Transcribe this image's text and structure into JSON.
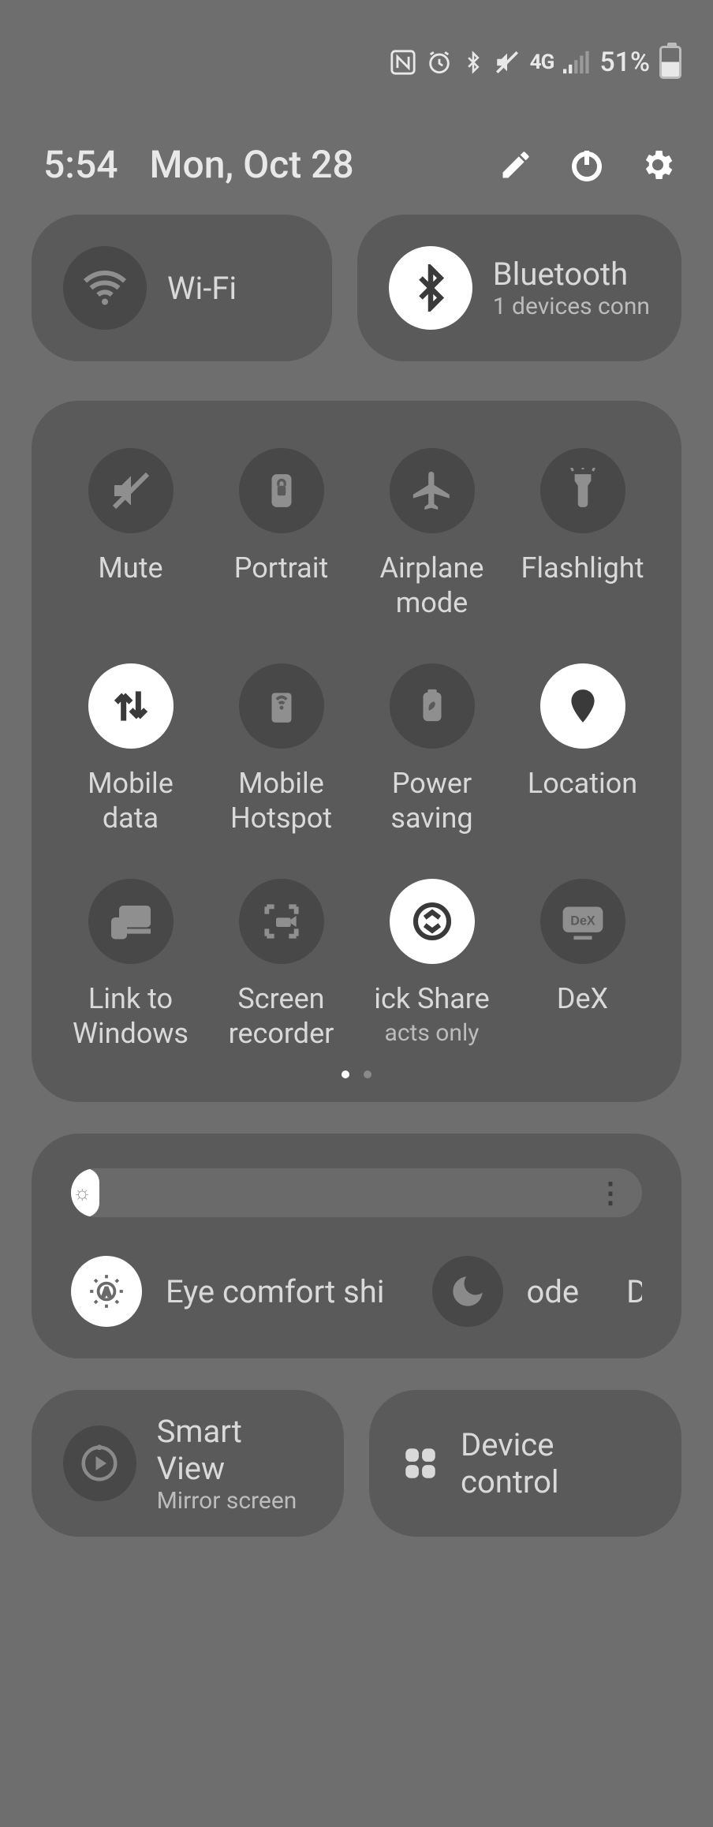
{
  "status": {
    "network_type": "4G",
    "battery_pct": "51%"
  },
  "header": {
    "time": "5:54",
    "date": "Mon, Oct 28"
  },
  "wide": {
    "wifi": {
      "label": "Wi-Fi",
      "active": false
    },
    "bluetooth": {
      "label": "Bluetooth",
      "sub": "1 devices conn",
      "active": true
    }
  },
  "qs": [
    {
      "id": "mute",
      "label": "Mute",
      "active": false,
      "icon": "mute"
    },
    {
      "id": "portrait",
      "label": "Portrait",
      "active": false,
      "icon": "lock-rotate"
    },
    {
      "id": "airplane",
      "label": "Airplane\nmode",
      "active": false,
      "icon": "airplane"
    },
    {
      "id": "flashlight",
      "label": "Flashlight",
      "active": false,
      "icon": "flashlight"
    },
    {
      "id": "mobile-data",
      "label": "Mobile\ndata",
      "active": true,
      "icon": "arrows"
    },
    {
      "id": "mobile-hotspot",
      "label": "Mobile\nHotspot",
      "active": false,
      "icon": "hotspot"
    },
    {
      "id": "power-saving",
      "label": "Power\nsaving",
      "active": false,
      "icon": "battery-leaf"
    },
    {
      "id": "location",
      "label": "Location",
      "active": true,
      "icon": "pin"
    },
    {
      "id": "link-windows",
      "label": "Link to\nWindows",
      "active": false,
      "icon": "devices"
    },
    {
      "id": "screen-recorder",
      "label": "Screen\nrecorder",
      "active": false,
      "icon": "record"
    },
    {
      "id": "quick-share",
      "label": "ick Share",
      "sub": "acts only",
      "active": true,
      "icon": "share"
    },
    {
      "id": "dex",
      "label": "DeX",
      "active": false,
      "icon": "dex"
    }
  ],
  "pager": {
    "pages": 2,
    "active": 0
  },
  "brightness": {
    "value_pct": 5,
    "eye_comfort": {
      "label": "Eye comfort shi",
      "active": true
    },
    "dark_mode": {
      "label": "ode",
      "trailing": "D",
      "active": false
    }
  },
  "bottom": {
    "smart_view": {
      "label": "Smart View",
      "sub": "Mirror screen"
    },
    "device_control": {
      "label": "Device control"
    }
  }
}
